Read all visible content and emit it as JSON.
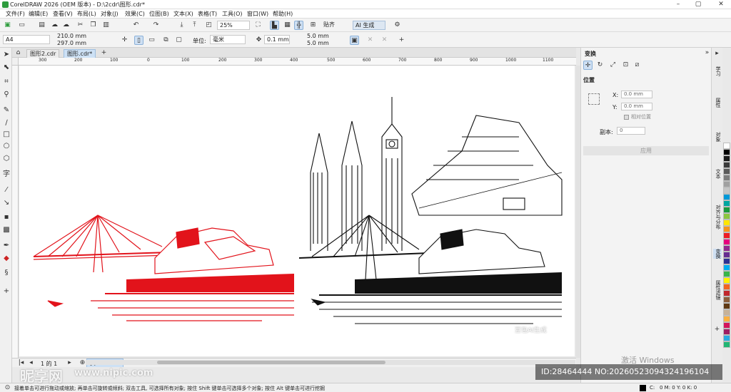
{
  "title": "CorelDRAW 2026 (OEM 版本) - D:\\2cdr\\图形.cdr*",
  "menu": [
    "文件(F)",
    "编辑(E)",
    "查看(V)",
    "布局(L)",
    "对象(J)",
    "效果(C)",
    "位图(B)",
    "文本(X)",
    "表格(T)",
    "工具(O)",
    "窗口(W)",
    "帮助(H)"
  ],
  "toolbar": {
    "zoom": "25%",
    "snap": "贴齐",
    "ai": "AI 生成"
  },
  "props": {
    "page_size": "A4",
    "width": "210.0 mm",
    "height": "297.0 mm",
    "units_label": "单位:",
    "units": "毫米",
    "nudge": "0.1 mm",
    "dup_x": "5.0 mm",
    "dup_y": "5.0 mm"
  },
  "tabs": [
    "图形2.cdr",
    "图形.cdr*"
  ],
  "ruler": [
    "300",
    "200",
    "100",
    "0",
    "100",
    "200",
    "300",
    "400",
    "500",
    "600",
    "700",
    "800",
    "900",
    "1000",
    "1100",
    "1200",
    "1300",
    "1400",
    "1500"
  ],
  "pagenav": {
    "pages": "1 的 1",
    "page_tab": "页 1"
  },
  "dock": {
    "title": "变换",
    "section": "位置",
    "x_label": "X:",
    "x_value": "0.0 mm",
    "y_label": "Y:",
    "y_value": "0.0 mm",
    "relative": "相对位置",
    "copies_label": "副本:",
    "copies_value": "0",
    "apply": "应用"
  },
  "side_tabs": [
    "学习",
    "属性",
    "对象",
    "文本",
    "对齐与分布",
    "变换",
    "属性滤镜"
  ],
  "palette": [
    "#ffffff",
    "#000000",
    "#1a1a1a",
    "#3a3a3a",
    "#5a5a5a",
    "#7c7c7c",
    "#a0a0a0",
    "#c6c6c6",
    "#0099d8",
    "#00a6a0",
    "#1c9a3c",
    "#8cc63f",
    "#ffe600",
    "#f7941d",
    "#ed1c24",
    "#e6007e",
    "#92278f",
    "#662d91",
    "#2e3192",
    "#00aeef",
    "#39b54a",
    "#fff200",
    "#f26522",
    "#c1272d",
    "#8b5e3c",
    "#603913",
    "#c7b299",
    "#fbb040",
    "#d4145a",
    "#9e1f63",
    "#29abe2",
    "#22b573"
  ],
  "status": {
    "hint": "接着单击可进行拖动或缩放; 再单击可旋转或倾斜; 双击工具, 可选择所有对象; 按住 Shift 键单击可选择多个对象; 按住 Alt 键单击可进行挖掘",
    "fill_label": "C:",
    "fill_value": "0 M: 0 Y: 0 K: 0"
  },
  "watermark": {
    "logo": "昵享网",
    "site": "www.nipic.com",
    "id": "ID:28464444 NO:20260523094324196104",
    "activate": "激活 Windows",
    "ai_mark": "豆包AI生成"
  }
}
